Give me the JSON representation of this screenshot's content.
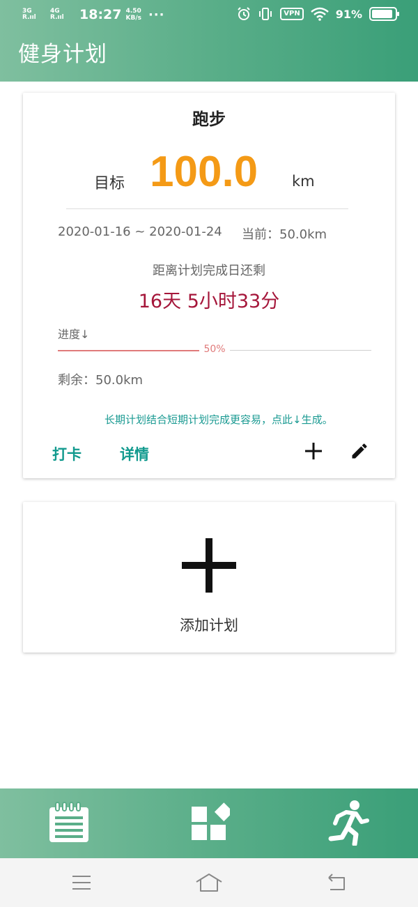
{
  "status_bar": {
    "net1_gen": "3G",
    "net1_bars": "R.ııl",
    "net2_gen": "4G",
    "net2_bars": "R.ııl",
    "time": "18:27",
    "speed_value": "4.50",
    "speed_unit": "KB/s",
    "dots": "···",
    "vpn": "VPN",
    "battery": "91%"
  },
  "header": {
    "title": "健身计划"
  },
  "plan_card": {
    "title": "跑步",
    "goal_label": "目标",
    "goal_value": "100.0",
    "goal_unit": "km",
    "date_range": "2020-01-16 ~ 2020-01-24",
    "current": "当前：50.0km",
    "remain_label": "距离计划完成日还剩",
    "countdown": "16天  5小时33分",
    "progress_label": "进度↓",
    "progress_fraction": 0.5,
    "progress_text": "50%",
    "remaining_amount": "剩余：50.0km",
    "tip": "长期计划结合短期计划完成更容易，点此↓生成。",
    "actions": {
      "checkin": "打卡",
      "detail": "详情"
    }
  },
  "add_card": {
    "label": "添加计划"
  },
  "colors": {
    "header_gradient_start": "#7fbf9f",
    "header_gradient_end": "#3a9f78",
    "goal_value": "#f49a16",
    "countdown": "#a5163a",
    "accent_teal": "#129a8e",
    "progress": "#e07a7a"
  },
  "icons": {
    "plus": "plus-icon",
    "edit": "pencil-icon",
    "add_plan": "large-plus-icon",
    "tab_plan": "notepad-icon",
    "tab_apps": "apps-grid-icon",
    "tab_run": "running-person-icon",
    "nav_menu": "menu-icon",
    "nav_home": "home-icon",
    "nav_back": "back-icon"
  }
}
